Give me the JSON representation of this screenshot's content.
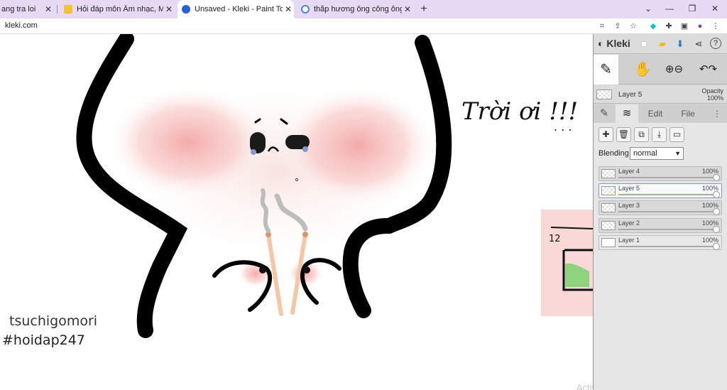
{
  "browser": {
    "tabs": [
      {
        "title": "ang tra loi"
      },
      {
        "title": "Hỏi đáp môn Âm nhạc, Mỹ thuật"
      },
      {
        "title": "Unsaved - Kleki - Paint Tool"
      },
      {
        "title": "thắp hương ông công ông táo -"
      }
    ],
    "url": "kleki.com",
    "accent": "#e8d9f5"
  },
  "canvas": {
    "drawn_text": "Trời ơi !!!",
    "sticky_note_text": "12",
    "credit_line1": "tsuchigomori",
    "credit_line2": "#hoidap247",
    "watermark": "Activate Windows"
  },
  "kleki": {
    "logo": "Kleki",
    "current_layer": {
      "name": "Layer 5",
      "opacity_label": "Opacity",
      "opacity_value": "100%"
    },
    "tabs": {
      "edit": "Edit",
      "file": "File"
    },
    "blending_label": "Blending",
    "blending_value": "normal",
    "layers": [
      {
        "name": "Layer 4",
        "opacity": "100%",
        "active": false
      },
      {
        "name": "Layer 5",
        "opacity": "100%",
        "active": true
      },
      {
        "name": "Layer 3",
        "opacity": "100%",
        "active": false
      },
      {
        "name": "Layer 2",
        "opacity": "100%",
        "active": false
      },
      {
        "name": "Layer 1",
        "opacity": "100%",
        "active": false
      }
    ]
  }
}
